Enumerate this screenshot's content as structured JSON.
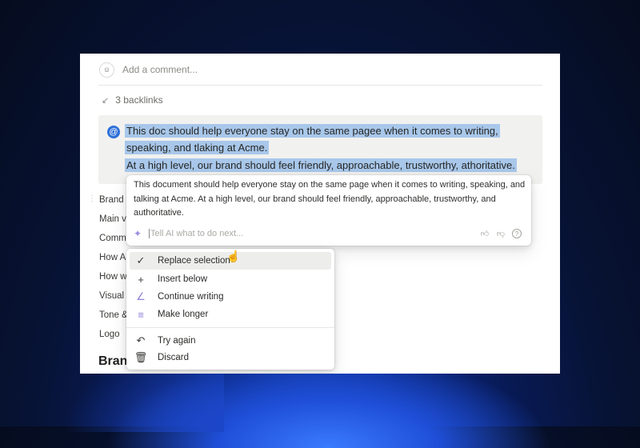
{
  "comment": {
    "placeholder": "Add a comment..."
  },
  "backlinks": {
    "label": "3 backlinks"
  },
  "callout": {
    "icon": "@",
    "line1": "This doc should help everyone stay on the same pagee when it comes to writing,",
    "line2": "speaking, and tlaking at Acme.",
    "line3": "At a high level, our brand should feel friendly, approachable, trustworthy, athoritative."
  },
  "toc": [
    "Brand",
    "Main v",
    "Comm",
    "How A",
    "How w",
    "Visual",
    "Tone &",
    "Logo"
  ],
  "heading": "Bran",
  "ai": {
    "response": "This document should help everyone stay on the same page when it comes to writing, speaking, and talking at Acme. At a high level, our brand should feel friendly, approachable, trustworthy, and authoritative.",
    "placeholder": "Tell AI what to do next...",
    "icons": [
      "thumbs-up-icon",
      "thumbs-down-icon",
      "help-icon"
    ]
  },
  "menu": {
    "items": [
      {
        "label": "Replace selection",
        "icon": "check-icon",
        "active": true
      },
      {
        "label": "Insert below",
        "icon": "plus-icon"
      },
      {
        "label": "Continue writing",
        "icon": "pen-icon"
      },
      {
        "label": "Make longer",
        "icon": "lines-icon"
      },
      {
        "label": "Try again",
        "icon": "undo-icon"
      },
      {
        "label": "Discard",
        "icon": "trash-icon"
      }
    ]
  }
}
